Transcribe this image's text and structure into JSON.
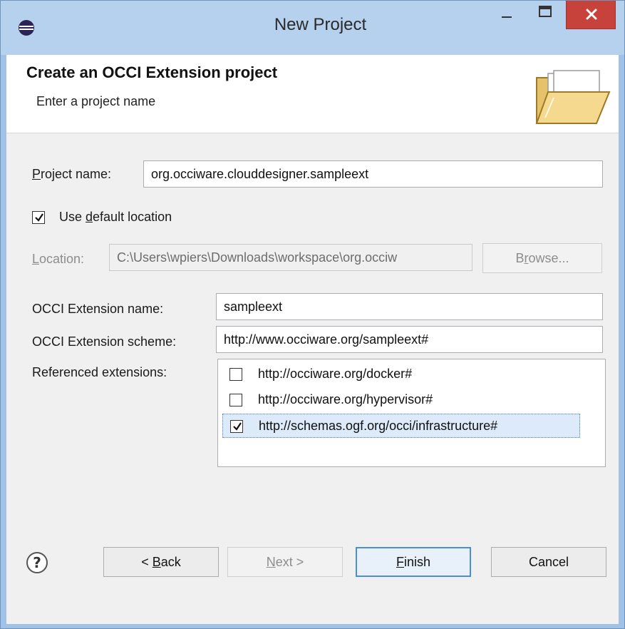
{
  "window": {
    "title": "New Project"
  },
  "header": {
    "title": "Create an OCCI Extension project",
    "subtitle": "Enter a project name"
  },
  "form": {
    "project_name": {
      "label": "Project name:",
      "value": "org.occiware.clouddesigner.sampleext"
    },
    "use_default_location": {
      "label": "Use default location",
      "checked": true
    },
    "location": {
      "label": "Location:",
      "value": "C:\\Users\\wpiers\\Downloads\\workspace\\org.occiw",
      "browse_label": "Browse..."
    },
    "extension_name": {
      "label": "OCCI Extension name:",
      "value": "sampleext"
    },
    "extension_scheme": {
      "label": "OCCI Extension scheme:",
      "value": "http://www.occiware.org/sampleext#"
    },
    "referenced_extensions": {
      "label": "Referenced extensions:",
      "items": [
        {
          "label": "http://occiware.org/docker#",
          "checked": false
        },
        {
          "label": "http://occiware.org/hypervisor#",
          "checked": false
        },
        {
          "label": "http://schemas.ogf.org/occi/infrastructure#",
          "checked": true
        }
      ]
    }
  },
  "footer": {
    "back_label": "< Back",
    "next_label": "Next >",
    "finish_label": "Finish",
    "cancel_label": "Cancel"
  },
  "colors": {
    "title_bar": "#b6d1ee",
    "close_button": "#c7423a",
    "dialog_bg": "#f0f0f0",
    "default_button_border": "#4b8dd6"
  },
  "icons": {
    "app": "eclipse-icon",
    "header": "open-folder-icon",
    "help": "help-icon"
  }
}
